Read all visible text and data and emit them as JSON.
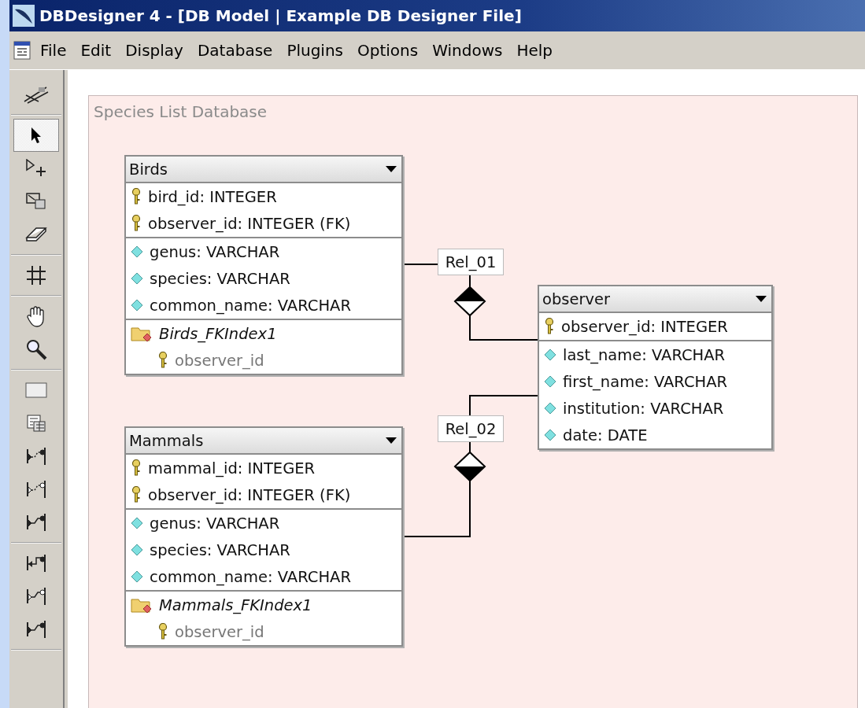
{
  "window": {
    "title": "DBDesigner 4 - [DB Model | Example DB Designer File]"
  },
  "menu": [
    "File",
    "Edit",
    "Display",
    "Database",
    "Plugins",
    "Options",
    "Windows",
    "Help"
  ],
  "toolbar": {
    "groups": [
      [
        {
          "kind": "design",
          "selected": false
        }
      ],
      [
        {
          "kind": "pointer",
          "selected": true
        },
        {
          "kind": "move",
          "selected": false
        },
        {
          "kind": "resize",
          "selected": false
        },
        {
          "kind": "eraser",
          "selected": false
        }
      ],
      [
        {
          "kind": "grid",
          "selected": false
        }
      ],
      [
        {
          "kind": "hand",
          "selected": false
        },
        {
          "kind": "zoom",
          "selected": false
        }
      ],
      [
        {
          "kind": "table",
          "selected": false
        },
        {
          "kind": "grid-table",
          "selected": false
        },
        {
          "kind": "relation-dotted",
          "selected": false
        },
        {
          "kind": "relation-dotted-open",
          "selected": false
        },
        {
          "kind": "relation-solid",
          "selected": false
        }
      ],
      [
        {
          "kind": "relation-arrow",
          "selected": false
        },
        {
          "kind": "relation-open",
          "selected": false
        },
        {
          "kind": "relation-solid",
          "selected": false
        }
      ]
    ]
  },
  "region": {
    "title": "Species List Database"
  },
  "tables": [
    {
      "name": "Birds",
      "keys": [
        "bird_id: INTEGER",
        "observer_id: INTEGER (FK)"
      ],
      "attributes": [
        "genus: VARCHAR",
        "species: VARCHAR",
        "common_name: VARCHAR"
      ],
      "indices": [
        {
          "name": "Birds_FKIndex1",
          "columns": [
            "observer_id"
          ]
        }
      ]
    },
    {
      "name": "Mammals",
      "keys": [
        "mammal_id: INTEGER",
        "observer_id: INTEGER (FK)"
      ],
      "attributes": [
        "genus: VARCHAR",
        "species: VARCHAR",
        "common_name: VARCHAR"
      ],
      "indices": [
        {
          "name": "Mammals_FKIndex1",
          "columns": [
            "observer_id"
          ]
        }
      ]
    },
    {
      "name": "observer",
      "keys": [
        "observer_id: INTEGER"
      ],
      "attributes": [
        "last_name: VARCHAR",
        "first_name: VARCHAR",
        "institution: VARCHAR",
        "date: DATE"
      ]
    }
  ],
  "relations": [
    {
      "label": "Rel_01"
    },
    {
      "label": "Rel_02"
    }
  ]
}
